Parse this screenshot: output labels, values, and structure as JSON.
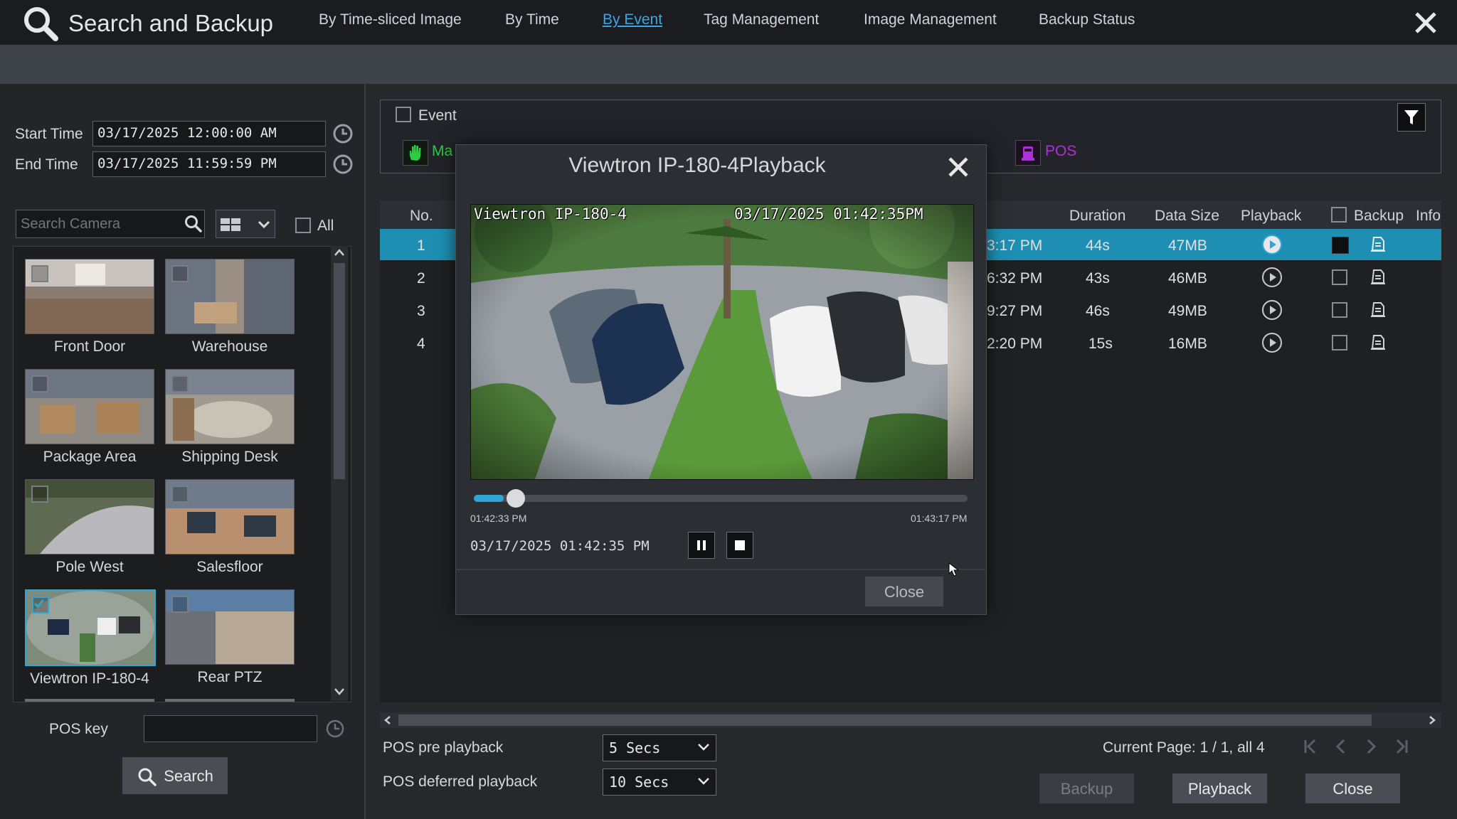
{
  "window": {
    "title": "Search and Backup"
  },
  "tabs": [
    {
      "label": "By Time-sliced Image",
      "active": false
    },
    {
      "label": "By Time",
      "active": false
    },
    {
      "label": "By Event",
      "active": true
    },
    {
      "label": "Tag Management",
      "active": false
    },
    {
      "label": "Image Management",
      "active": false
    },
    {
      "label": "Backup Status",
      "active": false
    }
  ],
  "left": {
    "start_time_label": "Start Time",
    "start_time_value": "03/17/2025 12:00:00 AM",
    "end_time_label": "End Time",
    "end_time_value": "03/17/2025 11:59:59 PM",
    "search_placeholder": "Search Camera",
    "all_label": "All",
    "cameras": [
      {
        "name": "Front Door",
        "checked": false
      },
      {
        "name": "Warehouse",
        "checked": false
      },
      {
        "name": "Package Area",
        "checked": false
      },
      {
        "name": "Shipping Desk",
        "checked": false
      },
      {
        "name": "Pole West",
        "checked": false
      },
      {
        "name": "Salesfloor",
        "checked": false
      },
      {
        "name": "Viewtron IP-180-4",
        "checked": true
      },
      {
        "name": "Rear PTZ",
        "checked": false
      }
    ],
    "pos_key_label": "POS key",
    "search_button": "Search"
  },
  "events": {
    "event_label": "Event",
    "manual_label": "Ma",
    "pos_label": "POS",
    "colors": {
      "manual": "#2ecc40",
      "pos": "#b22ddb"
    }
  },
  "table": {
    "headers": {
      "no": "No.",
      "duration": "Duration",
      "data_size": "Data Size",
      "playback": "Playback",
      "backup": "Backup",
      "info": "Info"
    },
    "rows": [
      {
        "no": "1",
        "time": "3:17 PM",
        "duration": "44s",
        "size": "47MB",
        "selected": true
      },
      {
        "no": "2",
        "time": "6:32 PM",
        "duration": "43s",
        "size": "46MB",
        "selected": false
      },
      {
        "no": "3",
        "time": "9:27 PM",
        "duration": "46s",
        "size": "49MB",
        "selected": false
      },
      {
        "no": "4",
        "time": "2:20 PM",
        "duration": "15s",
        "size": "16MB",
        "selected": false
      }
    ]
  },
  "bottom": {
    "pos_pre_label": "POS pre playback",
    "pos_pre_value": "5 Secs",
    "pos_deferred_label": "POS deferred playback",
    "pos_deferred_value": "10 Secs",
    "page_info": "Current Page: 1 / 1, all 4",
    "backup_button": "Backup",
    "playback_button": "Playback",
    "close_button": "Close"
  },
  "modal": {
    "title": "Viewtron IP-180-4Playback",
    "osd_camera": "Viewtron IP-180-4",
    "osd_timestamp": "03/17/2025 01:42:35PM",
    "progress_start": "01:42:33 PM",
    "progress_end": "01:43:17 PM",
    "progress_fraction": 0.06,
    "current_time": "03/17/2025 01:42:35 PM",
    "close_button": "Close"
  }
}
